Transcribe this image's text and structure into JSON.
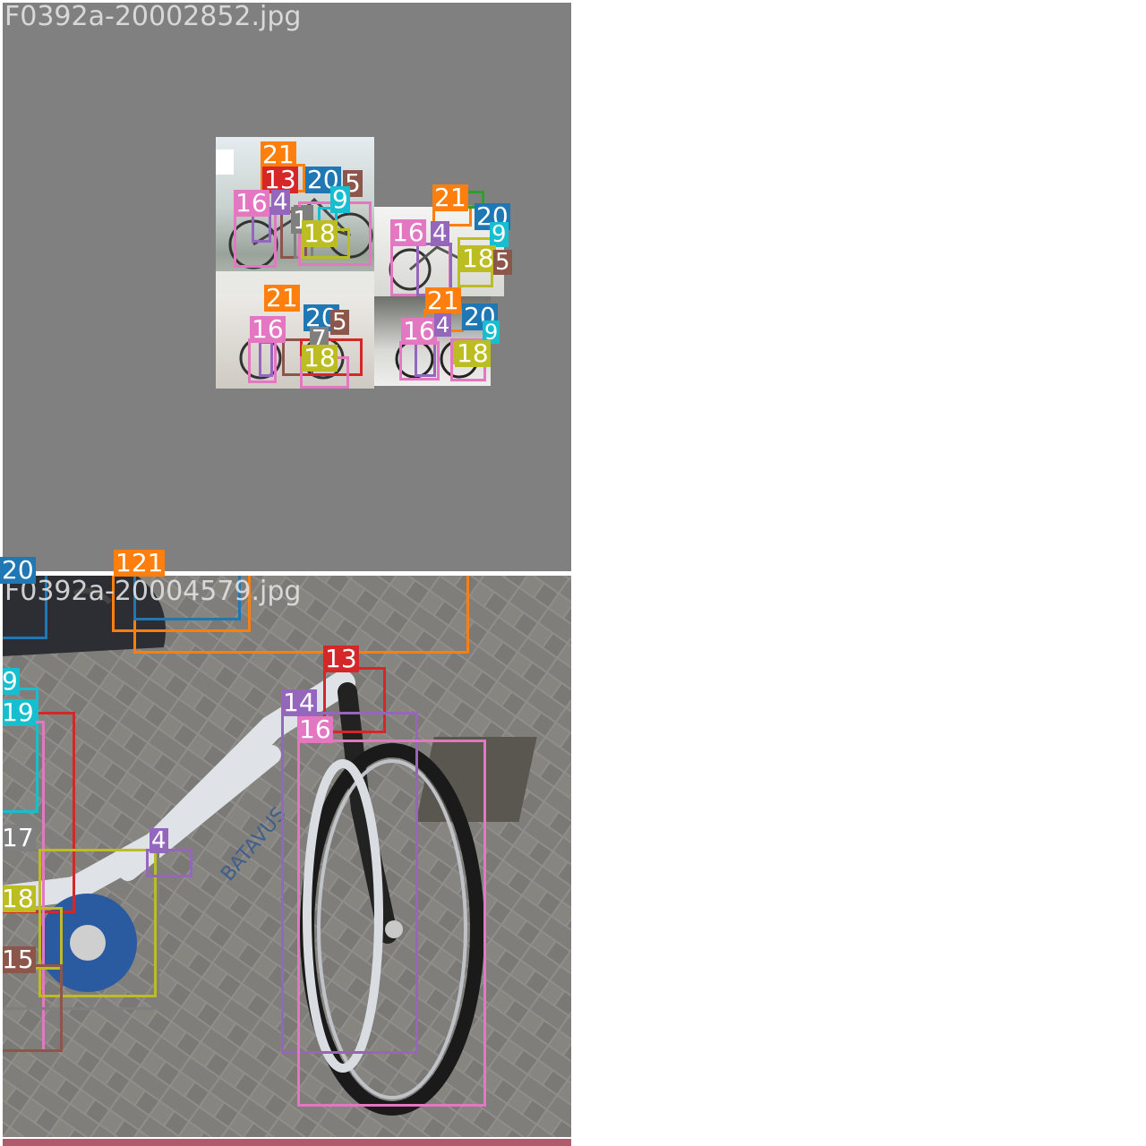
{
  "panels": {
    "top": {
      "filename": "F0392a-20002852.jpg"
    },
    "bottom": {
      "filename": "F0392a-20004579.jpg"
    }
  },
  "colors": {
    "c1": "#1f77b4",
    "c2": "#ff7f0e",
    "c3": "#2ca02c",
    "c4": "#d62728",
    "c5": "#9467bd",
    "c6": "#8c564b",
    "c7": "#e377c2",
    "c8": "#7f7f7f",
    "c9": "#bcbd22",
    "c10": "#17becf"
  },
  "top_labels": {
    "q1": [
      "21",
      "13",
      "20",
      "5",
      "9",
      "16",
      "4",
      "18",
      "1"
    ],
    "q2": [
      "21",
      "20",
      "16",
      "4",
      "9",
      "18",
      "5"
    ],
    "q3": [
      "21",
      "20",
      "16",
      "5",
      "7",
      "18"
    ],
    "q4": [
      "21",
      "20",
      "16",
      "4",
      "9",
      "18"
    ]
  },
  "bottom_labels": {
    "l20": "20",
    "l121": "121",
    "l13": "13",
    "l14": "14",
    "l16": "16",
    "l9": "9",
    "l19": "19",
    "l17": "17",
    "l4": "4",
    "l18": "18",
    "l15": "15"
  },
  "bike_text": "BATAVUS"
}
